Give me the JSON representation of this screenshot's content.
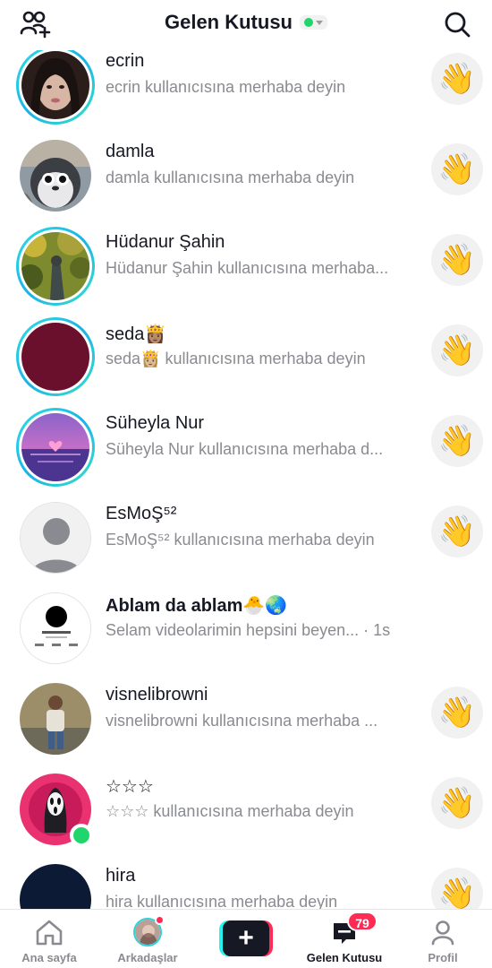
{
  "header": {
    "title": "Gelen Kutusu",
    "add_friends_icon": "add-people-icon",
    "search_icon": "search-icon",
    "status_color": "#20d56b"
  },
  "conversations": [
    {
      "name": "ecrin",
      "subtitle": "ecrin kullanıcısına merhaba deyin",
      "story": true
    },
    {
      "name": "damla",
      "subtitle": "damla kullanıcısına merhaba deyin",
      "story": false
    },
    {
      "name": "Hüdanur Şahin",
      "subtitle": "Hüdanur Şahin kullanıcısına merhaba...",
      "story": true
    },
    {
      "name": "seda👸🏽",
      "subtitle": "seda👸🏼 kullanıcısına merhaba deyin",
      "story": true
    },
    {
      "name": "Süheyla Nur",
      "subtitle": "Süheyla Nur kullanıcısına merhaba d...",
      "story": true
    },
    {
      "name": "EsMoŞ⁵²",
      "subtitle": "EsMoŞ⁵² kullanıcısına merhaba deyin",
      "story": false
    },
    {
      "name": "Ablam da ablam🐣🌏",
      "subtitle": "Selam videolarimin hepsini beyen... · 1s",
      "story": false,
      "unread": true
    },
    {
      "name": "visnelibrowni",
      "subtitle": "visnelibrowni kullanıcısına merhaba ...",
      "story": false
    },
    {
      "name": "☆☆☆",
      "subtitle": "☆☆☆ kullanıcısına merhaba deyin",
      "story": false,
      "online": true
    },
    {
      "name": "hira",
      "subtitle": "hira kullanıcısına merhaba deyin",
      "story": false
    }
  ],
  "wave_emoji": "👋",
  "bottom_nav": {
    "home": "Ana sayfa",
    "friends": "Arkadaşlar",
    "create": "+",
    "inbox": "Gelen Kutusu",
    "inbox_badge": "79",
    "profile": "Profil"
  }
}
